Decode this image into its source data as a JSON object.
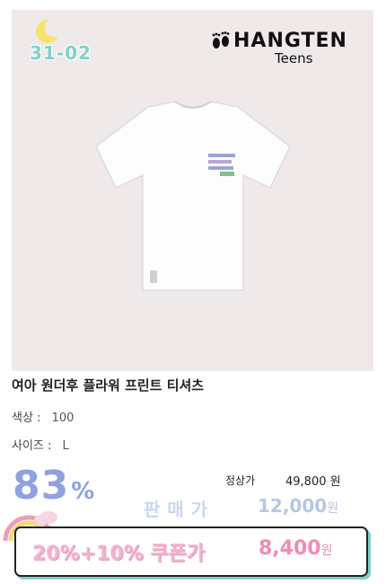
{
  "badge": {
    "code": "31-02"
  },
  "brand": {
    "name": "HANGTEN",
    "sub": "Teens"
  },
  "product": {
    "title": "여아 원더후 플라워 프린트 티셔츠",
    "color_label": "색상 :",
    "color_value": "100",
    "size_label": "사이즈 :",
    "size_value": "L"
  },
  "pricing": {
    "discount_number": "83",
    "discount_symbol": "%",
    "regular_label": "정상가",
    "regular_price": "49,800 원",
    "sale_label": "판매가",
    "sale_price": "12,000",
    "sale_currency": "원",
    "coupon_label": "20%+10% 쿠폰가",
    "coupon_price": "8,400",
    "coupon_currency": "원"
  },
  "colors": {
    "photo_bg": "#efe9e9",
    "mint": "#7fd0c8",
    "discount_blue": "#8fa2dd",
    "coupon_pink": "#f28ab8",
    "moon_yellow": "#f7e36b"
  }
}
